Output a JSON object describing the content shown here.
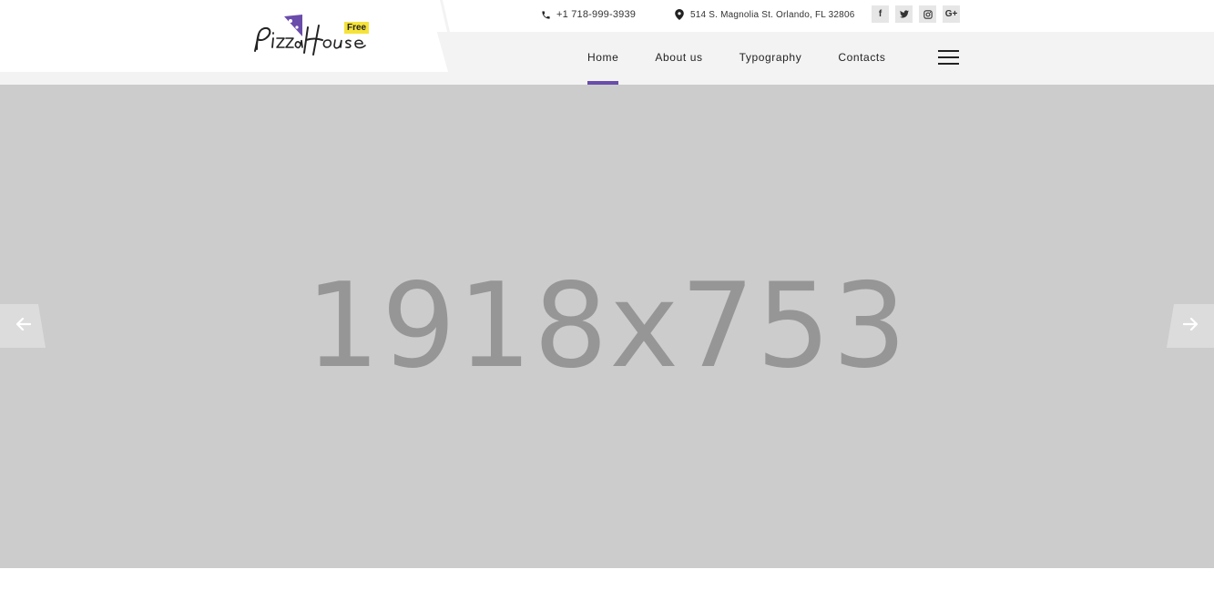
{
  "brand": {
    "logo_text": "PizzaHouse",
    "badge": "Free",
    "accent_color": "#6a4cab",
    "badge_color": "#f5e33a"
  },
  "contact": {
    "phone": "+1 718-999-3939",
    "address": "514 S. Magnolia St. Orlando, FL 32806",
    "phone_icon": "phone-icon",
    "address_icon": "map-pin-icon"
  },
  "socials": [
    {
      "name": "facebook",
      "glyph": "f"
    },
    {
      "name": "twitter",
      "glyph": "t"
    },
    {
      "name": "instagram",
      "glyph": "ig"
    },
    {
      "name": "google-plus",
      "glyph": "G+"
    }
  ],
  "nav": {
    "items": [
      {
        "label": "Home",
        "active": true
      },
      {
        "label": "About us",
        "active": false
      },
      {
        "label": "Typography",
        "active": false
      },
      {
        "label": "Contacts",
        "active": false
      }
    ],
    "menu_icon": "hamburger-icon"
  },
  "hero": {
    "placeholder_text": "1918x753",
    "background": "#cccccc",
    "prev_icon": "arrow-left-icon",
    "next_icon": "arrow-right-icon"
  }
}
